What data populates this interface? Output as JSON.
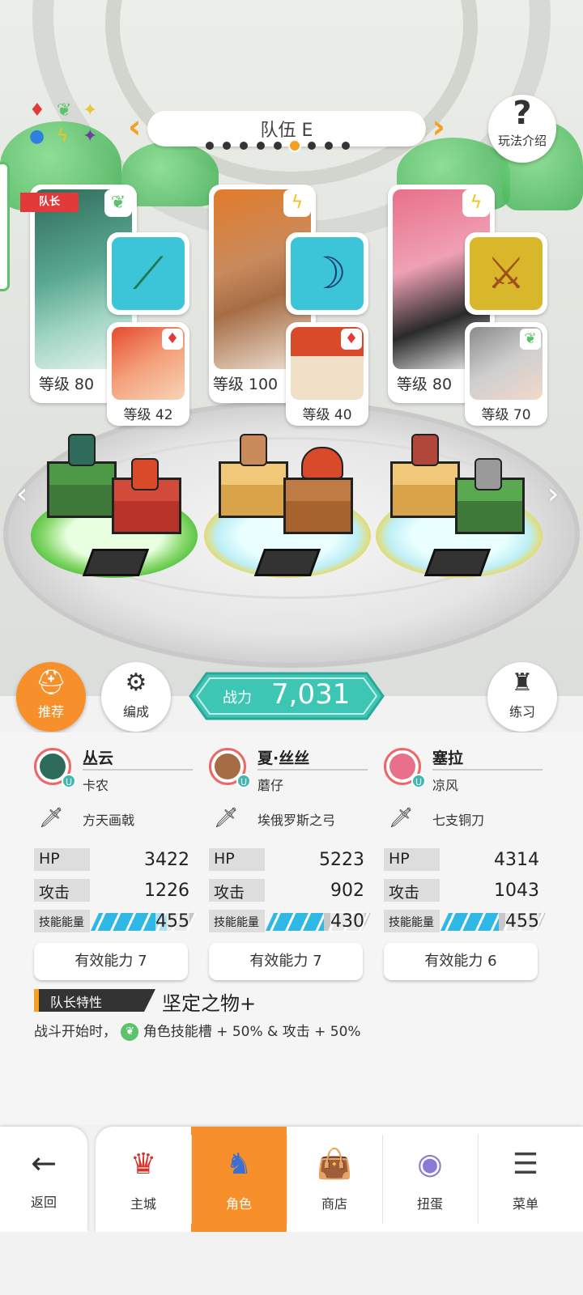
{
  "header": {
    "team_title": "队伍 E",
    "pager_dots": 9,
    "active_dot": 5,
    "help_label": "玩法介绍"
  },
  "leader_tag": "队长",
  "heroes": [
    {
      "element": "leaf",
      "level": "等级 80",
      "weapon_icon": "green-spear-icon",
      "sub_element": "red-gem",
      "sub_level": "等级 42",
      "accent": "#3fae8a"
    },
    {
      "element": "lightning",
      "level": "等级 100",
      "weapon_icon": "blue-bow-icon",
      "sub_element": "red-gem",
      "sub_level": "等级 40",
      "accent": "#e8a64a"
    },
    {
      "element": "lightning",
      "level": "等级 80",
      "weapon_icon": "bronze-sword-icon",
      "sub_element": "leaf",
      "sub_level": "等级 70",
      "accent": "#e98aa0"
    }
  ],
  "controls": {
    "recommend_label": "推荐",
    "formation_label": "编成",
    "practice_label": "练习",
    "power_label": "战力",
    "power_value": "7,031"
  },
  "stats": [
    {
      "name": "丛云",
      "sub_name": "卡农",
      "weapon": "方天画戟",
      "hp_label": "HP",
      "hp": "3422",
      "atk_label": "攻击",
      "atk": "1226",
      "energy_label": "技能能量",
      "energy": "455",
      "energy_fill": 0.72,
      "ability": "有效能力 7"
    },
    {
      "name": "夏·丝丝",
      "sub_name": "蘑仔",
      "weapon": "埃俄罗斯之弓",
      "hp_label": "HP",
      "hp": "5223",
      "atk_label": "攻击",
      "atk": "902",
      "energy_label": "技能能量",
      "energy": "430",
      "energy_fill": 0.55,
      "ability": "有效能力 7"
    },
    {
      "name": "塞拉",
      "sub_name": "凉风",
      "weapon": "七支铜刀",
      "hp_label": "HP",
      "hp": "4314",
      "atk_label": "攻击",
      "atk": "1043",
      "energy_label": "技能能量",
      "energy": "455",
      "energy_fill": 0.55,
      "ability": "有效能力 6"
    }
  ],
  "leader_skill": {
    "tag": "队长特性",
    "name": "坚定之物+",
    "desc_prefix": "战斗开始时，",
    "desc_suffix": "角色技能槽 + 50% & 攻击 + 50%"
  },
  "nav": {
    "back_label": "返回",
    "tabs": [
      {
        "label": "主城",
        "icon": "castle-icon"
      },
      {
        "label": "角色",
        "icon": "knight-icon",
        "active": true
      },
      {
        "label": "商店",
        "icon": "shop-bag-icon"
      },
      {
        "label": "扭蛋",
        "icon": "gacha-orb-icon"
      },
      {
        "label": "菜单",
        "icon": "menu-list-icon"
      }
    ]
  },
  "colors": {
    "accent": "#f7902a",
    "power": "#3ec6b5",
    "leaf": "#5cc36a",
    "energy": "#2fb8e6"
  }
}
